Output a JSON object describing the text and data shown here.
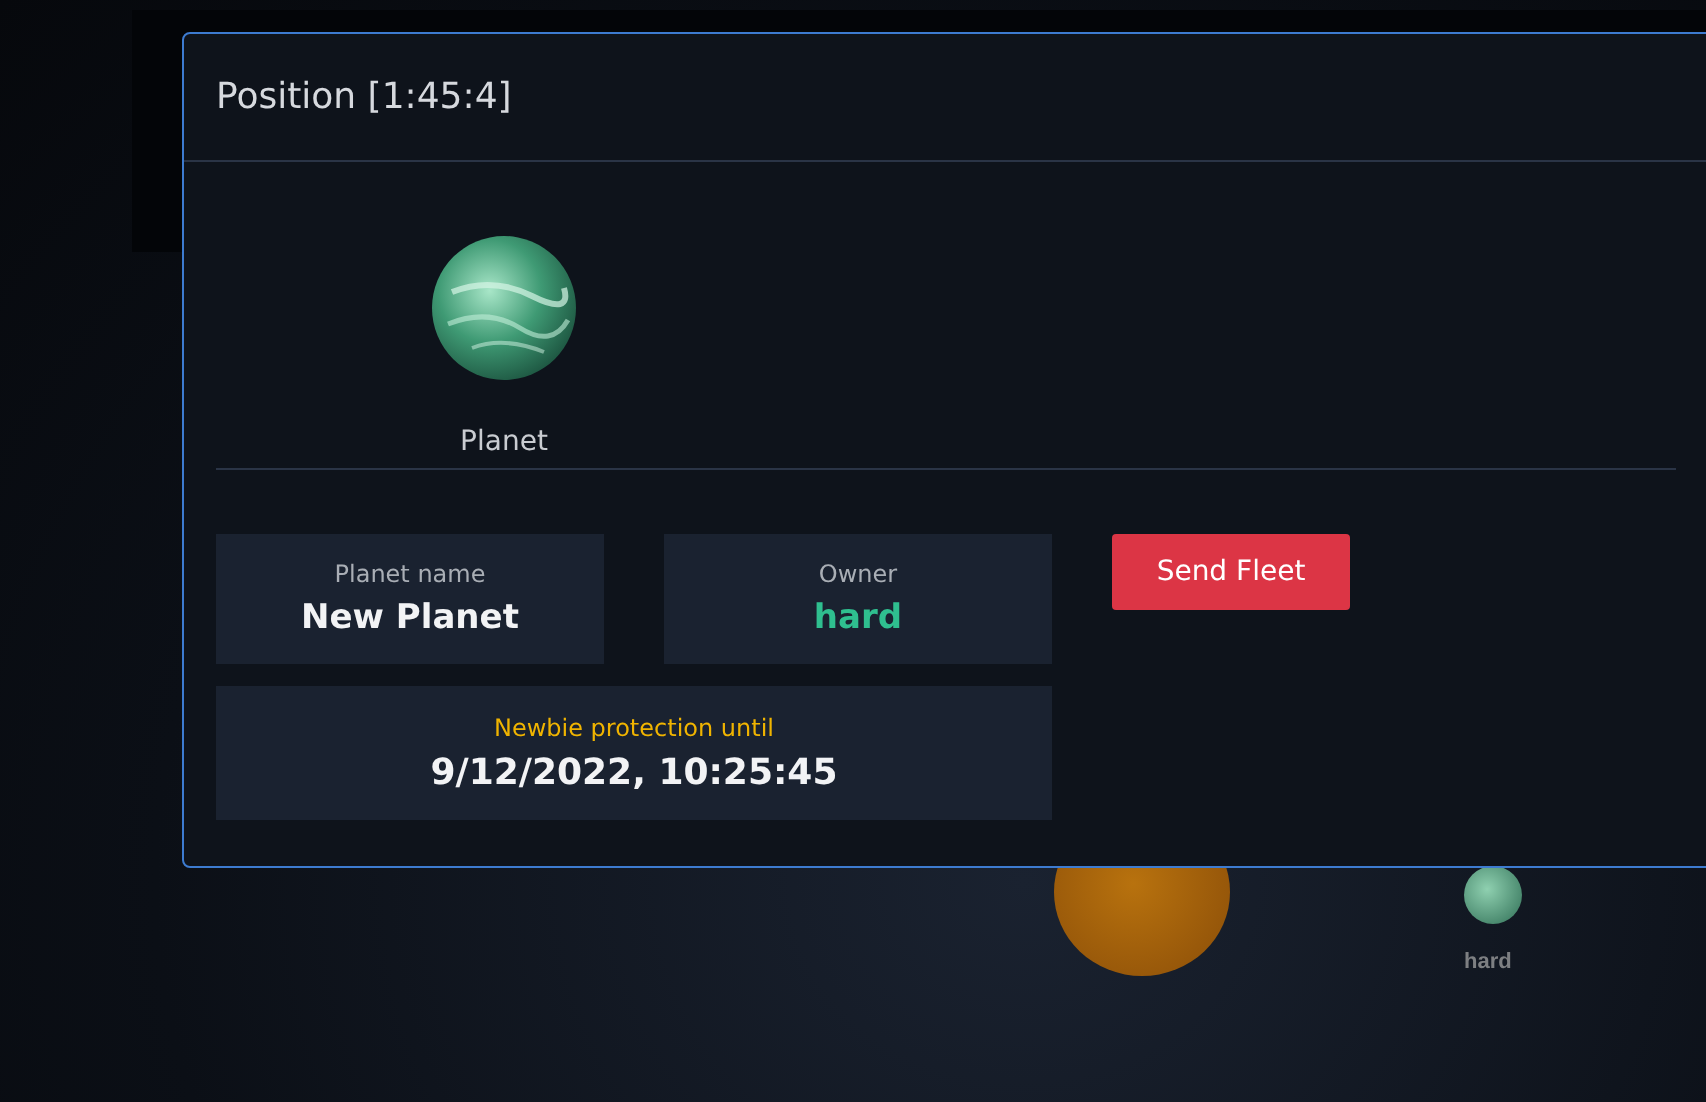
{
  "modal": {
    "title": "Position [1:45:4]",
    "object_label": "Planet",
    "fields": [
      {
        "label": "Planet name",
        "value": "New Planet",
        "kind": "plain"
      },
      {
        "label": "Owner",
        "value": "hard",
        "kind": "owner"
      }
    ],
    "protection": {
      "label": "Newbie protection until",
      "value": "9/12/2022, 10:25:45"
    },
    "button": "Send Fleet"
  },
  "map": {
    "planet_owner": "hard"
  }
}
